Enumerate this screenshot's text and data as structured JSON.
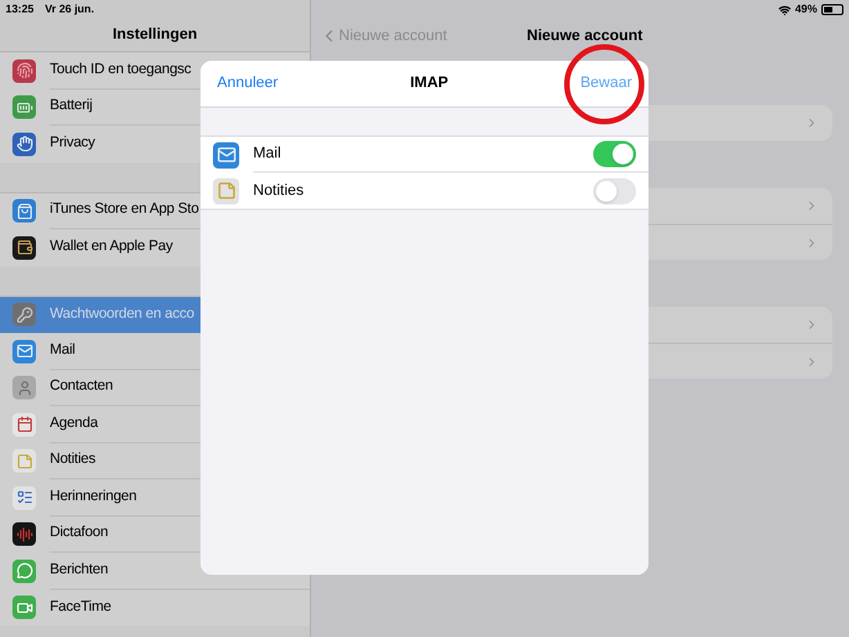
{
  "status_bar": {
    "time": "13:25",
    "date": "Vr 26 jun.",
    "battery": "49%"
  },
  "sidebar": {
    "title": "Instellingen",
    "groups": [
      {
        "items": [
          {
            "label": "Touch ID en toegangsc",
            "selected": false
          },
          {
            "label": "Batterij",
            "selected": false
          },
          {
            "label": "Privacy",
            "selected": false
          }
        ]
      },
      {
        "items": [
          {
            "label": "iTunes Store en App Sto",
            "selected": false
          },
          {
            "label": "Wallet en Apple Pay",
            "selected": false
          }
        ]
      },
      {
        "items": [
          {
            "label": "Wachtwoorden en acco",
            "selected": true
          },
          {
            "label": "Mail",
            "selected": false
          },
          {
            "label": "Contacten",
            "selected": false
          },
          {
            "label": "Agenda",
            "selected": false
          },
          {
            "label": "Notities",
            "selected": false
          },
          {
            "label": "Herinneringen",
            "selected": false
          },
          {
            "label": "Dictafoon",
            "selected": false
          },
          {
            "label": "Berichten",
            "selected": false
          },
          {
            "label": "FaceTime",
            "selected": false
          }
        ]
      }
    ]
  },
  "detail": {
    "back_label": "Nieuwe account",
    "title": "Nieuwe account",
    "cards": [
      {
        "rows": [
          {
            "kind": "disclosure"
          }
        ]
      },
      {
        "rows": [
          {
            "kind": "disclosure"
          },
          {
            "kind": "disclosure"
          }
        ]
      },
      {
        "rows": [
          {
            "kind": "disclosure"
          },
          {
            "kind": "disclosure"
          }
        ]
      }
    ]
  },
  "modal": {
    "cancel": "Annuleer",
    "title": "IMAP",
    "save": "Bewaar",
    "save_highlighted": true,
    "toggles": [
      {
        "label": "Mail",
        "on": true
      },
      {
        "label": "Notities",
        "on": false
      }
    ]
  }
}
